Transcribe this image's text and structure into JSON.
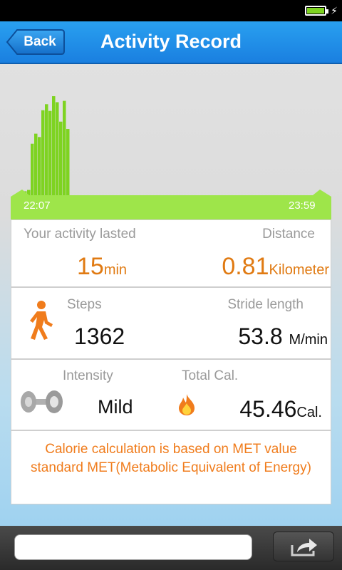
{
  "nav": {
    "title": "Activity Record",
    "back_label": "Back"
  },
  "chart_data": {
    "type": "bar",
    "x_start_label": "22:07",
    "x_end_label": "23:59",
    "values": [
      7,
      9,
      78,
      93,
      88,
      128,
      137,
      127,
      149,
      140,
      111,
      142,
      100
    ],
    "color": "#7ed321"
  },
  "activity": {
    "lasted_label": "Your activity lasted",
    "lasted_value": "15",
    "lasted_unit": "min",
    "distance_label": "Distance",
    "distance_value": "0.81",
    "distance_unit": "Kilometer"
  },
  "steps": {
    "label": "Steps",
    "value": "1362",
    "stride_label": "Stride length",
    "stride_value": "53.8",
    "stride_unit": "M/min"
  },
  "intensity": {
    "label": "Intensity",
    "value": "Mild",
    "cal_label": "Total Cal.",
    "cal_value": "45.46",
    "cal_unit": "Cal."
  },
  "note": "Calorie calculation is based on MET value standard MET(Metabolic Equivalent of Energy)",
  "bottom": {
    "input_placeholder": ""
  },
  "colors": {
    "accent_orange": "#e07a12",
    "bar_green": "#7ed321",
    "nav_blue": "#1a8de8"
  }
}
